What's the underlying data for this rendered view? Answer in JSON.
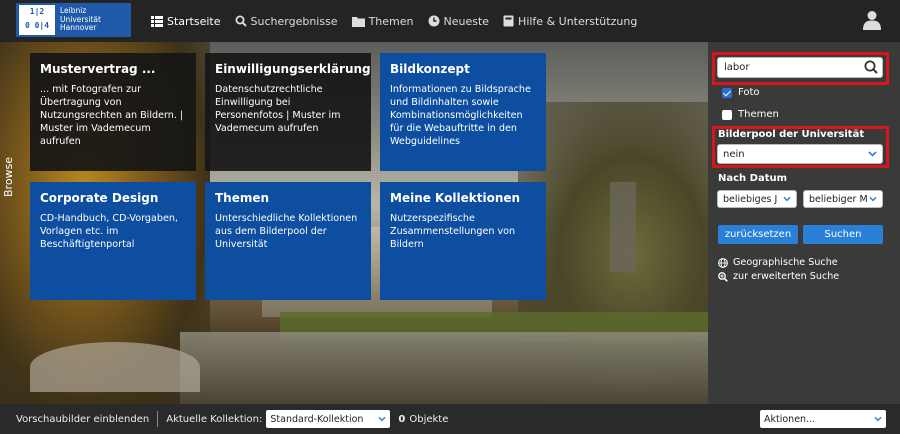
{
  "header": {
    "logo": {
      "grid": [
        "1|2",
        "0 0|4"
      ],
      "lines": [
        "Leibniz",
        "Universität",
        "Hannover"
      ]
    },
    "nav": [
      {
        "label": "Startseite",
        "icon": "grid-icon",
        "active": true
      },
      {
        "label": "Suchergebnisse",
        "icon": "search-icon"
      },
      {
        "label": "Themen",
        "icon": "folder-icon"
      },
      {
        "label": "Neueste",
        "icon": "clock-icon"
      },
      {
        "label": "Hilfe & Unterstützung",
        "icon": "book-icon"
      }
    ],
    "user_icon": "user-icon"
  },
  "browse_label": "Browse",
  "tiles": [
    {
      "title": "Mustervertrag ...",
      "text": "... mit Fotografen zur Übertragung von Nutzungsrechten an Bildern. | Muster im Vademecum aufrufen",
      "style": "dark"
    },
    {
      "title": "Einwilligungserklärung",
      "text": "Datenschutzrechtliche Einwilligung bei Personenfotos | Muster im Vademecum aufrufen",
      "style": "dark"
    },
    {
      "title": "Bildkonzept",
      "text": "Informationen zu Bildsprache und Bildinhalten sowie Kombinationsmöglichkeiten für die Webauftritte in den Webguidelines",
      "style": "blue"
    },
    {
      "title": "Corporate Design",
      "text": "CD-Handbuch, CD-Vorgaben, Vorlagen etc. im Beschäftigtenportal",
      "style": "blue"
    },
    {
      "title": "Themen",
      "text": "Unterschiedliche Kollektionen aus dem Bilderpool der Universität",
      "style": "blue"
    },
    {
      "title": "Meine Kollektionen",
      "text": "Nutzerspezifische Zusammenstellungen von Bildern",
      "style": "blue"
    }
  ],
  "sidebar": {
    "search": {
      "value": "labor",
      "placeholder": ""
    },
    "checkbox_foto": {
      "label": "Foto",
      "checked": true
    },
    "checkbox_themen": {
      "label": "Themen",
      "checked": false
    },
    "bilderpool_label": "Bilderpool der Universität",
    "bilderpool_value": "nein",
    "date_label": "Nach Datum",
    "date_year": "beliebiges J",
    "date_month": "beliebiger M",
    "reset_label": "zurücksetzen",
    "search_label": "Suchen",
    "geo_link": "Geographische Suche",
    "advanced_link": "zur erweiterten Suche"
  },
  "bottom": {
    "thumbnails": "Vorschaubilder einblenden",
    "collection_label": "Aktuelle Kollektion:",
    "collection_value": "Standard-Kollektion",
    "count": "0",
    "objects": "Objekte",
    "actions": "Aktionen..."
  },
  "colors": {
    "accent": "#0d4ea0",
    "button": "#2a80d6",
    "highlight": "#d9141b",
    "header": "#242424"
  }
}
